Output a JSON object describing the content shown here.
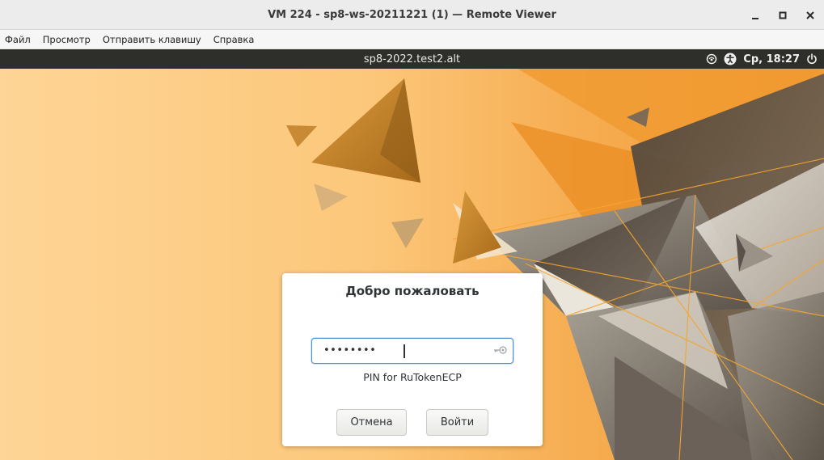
{
  "window": {
    "title": "VM 224 - sp8-ws-20211221 (1) — Remote Viewer",
    "controls": [
      "minimize-icon",
      "maximize-icon",
      "close-icon"
    ]
  },
  "menubar": {
    "items": [
      "Файл",
      "Просмотр",
      "Отправить клавишу",
      "Справка"
    ]
  },
  "guest": {
    "topbar": {
      "hostname": "sp8-2022.test2.alt",
      "clock": "Ср, 18:27",
      "icons": [
        "input-source-icon",
        "accessibility-icon",
        "power-icon"
      ]
    },
    "login": {
      "title": "Добро пожаловать",
      "pin_value": "••••••••",
      "pin_hint": "PIN for RuTokenECP",
      "cancel_label": "Отмена",
      "login_label": "Войти",
      "field_icon": "key-icon"
    },
    "colors": {
      "accent_focus": "#4a90d9",
      "topbar_bg": "#2e2e2b",
      "wallpaper_orange": "#f5a84a",
      "wallpaper_cream": "#fdd79a"
    }
  }
}
